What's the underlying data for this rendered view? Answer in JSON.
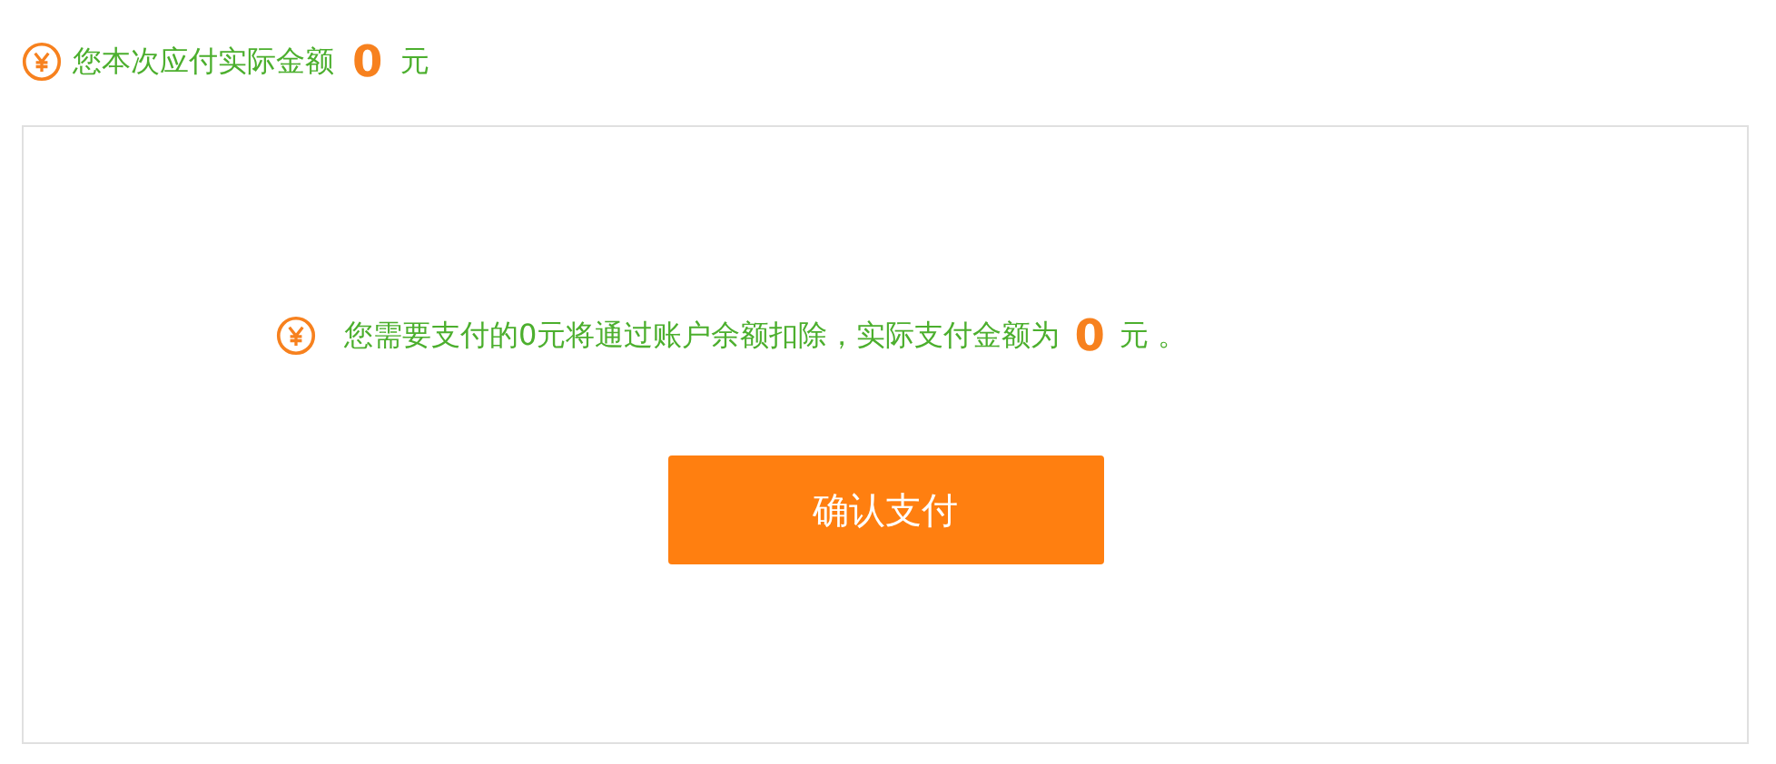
{
  "summary": {
    "label": "您本次应付实际金额",
    "amount": "0",
    "unit": "元"
  },
  "notice": {
    "text": "您需要支付的0元将通过账户余额扣除，实际支付金额为",
    "amount": "0",
    "unit": "元 。"
  },
  "confirm_button": {
    "label": "确认支付"
  }
}
